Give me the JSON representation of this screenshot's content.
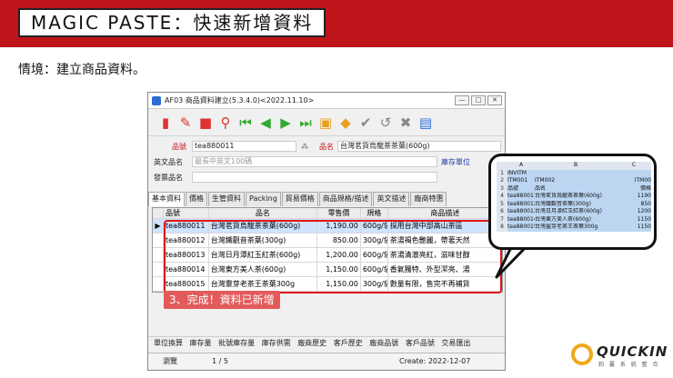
{
  "banner": {
    "title": "MAGIC PASTE：快速新增資料"
  },
  "context": "情境：建立商品資料。",
  "window": {
    "title": "AF03 商品資料建立(5.3.4.0)<2022.11.10>",
    "buttons": [
      "—",
      "□",
      "✕"
    ]
  },
  "form": {
    "code_label": "品號",
    "code_value": "tea880011",
    "name_label": "品名",
    "name_value": "台灣茗貨烏龍茶茶葉(600g)",
    "en_name_label": "英文品名",
    "en_name_placeholder": "最長中英文100碼",
    "unit_label": "庫存單位",
    "invoice_label": "發票品名"
  },
  "tabs": [
    "基本資料",
    "價格",
    "生管資料",
    "Packing",
    "貿易價格",
    "商品規格/描述",
    "英文描述",
    "廠商特惠"
  ],
  "grid": {
    "headers": [
      "",
      "品號",
      "品名",
      "零售價",
      "規格",
      "商品描述"
    ],
    "rows": [
      {
        "marker": "▶",
        "code": "tea880011",
        "name": "台灣茗貨烏龍茶茶葉(600g)",
        "price": "1,190.00",
        "spec": "600g/袋",
        "desc": "採用台灣中部高山茶區"
      },
      {
        "marker": "",
        "code": "tea880012",
        "name": "台灣鐵觀音茶葉(300g)",
        "price": "850.00",
        "spec": "300g/袋",
        "desc": "茶湯褐色艷麗，帶著天然"
      },
      {
        "marker": "",
        "code": "tea880013",
        "name": "台灣日月潭紅玉紅茶(600g)",
        "price": "1,200.00",
        "spec": "600g/袋",
        "desc": "茶湯清澈亮紅，滋味甘醇"
      },
      {
        "marker": "",
        "code": "tea880014",
        "name": "台灣東方美人茶(600g)",
        "price": "1,150.00",
        "spec": "600g/袋",
        "desc": "香氣獨特、外型潔亮、湯"
      },
      {
        "marker": "",
        "code": "tea880015",
        "name": "台灣靈芽老茶王茶葉300g",
        "price": "1,150.00",
        "spec": "300g/袋",
        "desc": "數量有限，售完不再補貨"
      }
    ]
  },
  "callout": "3、完成！資料已新增",
  "bottom_tabs": [
    "單位換算",
    "庫存量",
    "批號庫存量",
    "庫存供需",
    "廠商歷史",
    "客戶歷史",
    "廠商品號",
    "客戶品號",
    "交易匯出"
  ],
  "status": {
    "mode": "瀏覽",
    "record": "1 / 5",
    "created": "Create: 2022-12-07"
  },
  "excel": {
    "columns": [
      "",
      "A",
      "B",
      "C"
    ],
    "rows": [
      [
        "1",
        "INVITM",
        "",
        ""
      ],
      [
        "2",
        "ITM001",
        "ITM002",
        "ITM00"
      ],
      [
        "3",
        "品號",
        "品名",
        "價格"
      ],
      [
        "4",
        "tea880011",
        "台灣茗貨烏龍茶茶葉(600g)",
        "1190"
      ],
      [
        "5",
        "tea880012",
        "台灣鐵觀音茶葉(300g)",
        "850"
      ],
      [
        "6",
        "tea880013",
        "台灣日月潭紅玉紅茶(600g)",
        "1200"
      ],
      [
        "7",
        "tea880014",
        "台灣東方美人茶(600g)",
        "1150"
      ],
      [
        "8",
        "tea880015",
        "台灣靈芽老茶王茶葉300g",
        "1150"
      ]
    ]
  },
  "logo": {
    "name": "QUICKIN",
    "sub": "鈞 贏 系 統 整 合"
  },
  "colors": {
    "brand_red": "#c0141b",
    "accent_orange": "#f0a81b",
    "selection_blue": "#cfe3ff"
  }
}
